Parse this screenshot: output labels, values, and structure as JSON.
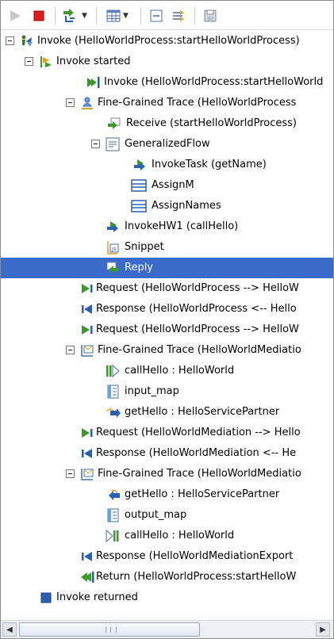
{
  "toolbar": {
    "buttons": [
      {
        "name": "run-icon"
      },
      {
        "name": "stop-icon"
      },
      {
        "name": "step-icon",
        "dropdown": true
      },
      {
        "name": "table-icon",
        "dropdown": true
      },
      {
        "name": "collapse-icon"
      },
      {
        "name": "filter-icon"
      },
      {
        "name": "save-icon"
      }
    ]
  },
  "tree": {
    "rows": [
      {
        "label": "Invoke (HelloWorldProcess:startHelloWorldProcess)",
        "icon": "invoke-icon",
        "expander": true
      },
      {
        "label": "Invoke started",
        "icon": "invoke-started-icon",
        "expander": true
      },
      {
        "label": "Invoke (HelloWorldProcess:startHelloWorld",
        "icon": "invoke-arrow-icon"
      },
      {
        "label": "Fine-Grained Trace (HelloWorldProcess",
        "icon": "trace-icon",
        "expander": true
      },
      {
        "label": "Receive (startHelloWorldProcess)",
        "icon": "receive-icon"
      },
      {
        "label": "GeneralizedFlow",
        "icon": "flow-icon",
        "expander": true
      },
      {
        "label": "InvokeTask (getName)",
        "icon": "invoke-task-icon"
      },
      {
        "label": "AssignM",
        "icon": "assign-icon"
      },
      {
        "label": "AssignNames",
        "icon": "assign-icon"
      },
      {
        "label": "InvokeHW1 (callHello)",
        "icon": "invoke-task-icon"
      },
      {
        "label": "Snippet",
        "icon": "snippet-icon"
      },
      {
        "label": "Reply",
        "icon": "reply-icon",
        "selected": true
      },
      {
        "label": "Request (HelloWorldProcess --> HelloW",
        "icon": "request-icon"
      },
      {
        "label": "Response (HelloWorldProcess <-- Hello",
        "icon": "response-icon"
      },
      {
        "label": "Request (HelloWorldProcess --> HelloW",
        "icon": "request-icon"
      },
      {
        "label": "Fine-Grained Trace (HelloWorldMediatio",
        "icon": "mediation-trace-icon",
        "expander": true
      },
      {
        "label": "callHello : HelloWorld",
        "icon": "call-icon"
      },
      {
        "label": "input_map",
        "icon": "map-icon"
      },
      {
        "label": "getHello : HelloServicePartner",
        "icon": "partner-icon"
      },
      {
        "label": "Request (HelloWorldMediation --> Hello",
        "icon": "request-icon"
      },
      {
        "label": "Response (HelloWorldMediation <-- He",
        "icon": "response-icon"
      },
      {
        "label": "Fine-Grained Trace (HelloWorldMediatio",
        "icon": "mediation-trace-icon",
        "expander": true
      },
      {
        "label": "getHello : HelloServicePartner",
        "icon": "partner-return-icon"
      },
      {
        "label": "output_map",
        "icon": "map-icon"
      },
      {
        "label": "callHello : HelloWorld",
        "icon": "call-return-icon"
      },
      {
        "label": "Response (HelloWorldMediationExport",
        "icon": "response-icon"
      },
      {
        "label": "Return (HelloWorldProcess:startHelloW",
        "icon": "return-icon"
      },
      {
        "label": "Invoke returned",
        "icon": "invoke-returned-icon"
      }
    ]
  },
  "scrollbar": {
    "left_icon": "scroll-left-icon",
    "right_icon": "scroll-right-icon"
  },
  "colors": {
    "selection": "#3a6bc8",
    "accent_green": "#3c9a2d",
    "accent_blue": "#2b5fb5"
  }
}
